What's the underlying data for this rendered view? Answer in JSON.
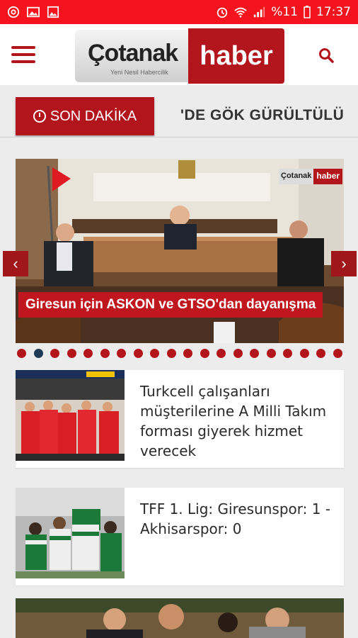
{
  "status_bar": {
    "left_icons": [
      "at-sign-icon",
      "image-icon",
      "photo-gallery-icon"
    ],
    "right_icons": [
      "alarm-icon",
      "wifi-icon",
      "signal-icon",
      "battery-icon"
    ],
    "battery": "%11",
    "time": "17:37"
  },
  "header": {
    "logo_word_left": "Çotanak",
    "logo_slogan": "Yeni Nesil Habercilik",
    "logo_word_right": "haber"
  },
  "ticker": {
    "label": "SON DAKİKA",
    "headline_fragment": "'DE GÖK GÜRÜLTÜLÜ"
  },
  "slider": {
    "caption": "Giresun için ASKON ve GTSO'dan dayanışma",
    "watermark_left": "Çotanak",
    "watermark_right": "haber",
    "prev_symbol": "‹",
    "next_symbol": "›",
    "dot_count": 20,
    "active_dot_index": 1
  },
  "news": [
    {
      "title": "Turkcell çalışanları müşterilerine A Milli Takım forması giyerek hizmet verecek"
    },
    {
      "title": "TFF 1. Lig: Giresunspor: 1 - Akhisarspor: 0"
    }
  ],
  "colors": {
    "brand": "#b3151c",
    "status_bar": "#f5141e",
    "active_dot": "#1f3a55"
  }
}
